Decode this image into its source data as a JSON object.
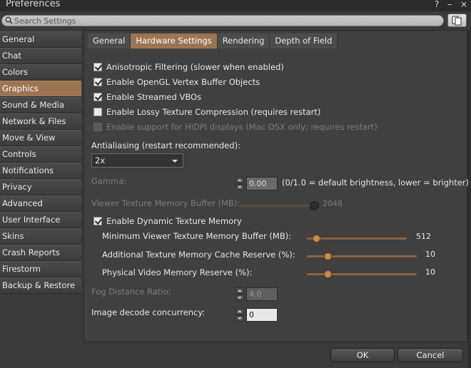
{
  "window": {
    "title": "Preferences",
    "help_glyph": "?",
    "minimize_glyph": "–",
    "close_glyph": "×"
  },
  "search": {
    "placeholder": "Search Settings"
  },
  "sidebar": {
    "items": [
      {
        "label": "General"
      },
      {
        "label": "Chat"
      },
      {
        "label": "Colors"
      },
      {
        "label": "Graphics",
        "active": true
      },
      {
        "label": "Sound & Media"
      },
      {
        "label": "Network & Files"
      },
      {
        "label": "Move & View"
      },
      {
        "label": "Controls"
      },
      {
        "label": "Notifications"
      },
      {
        "label": "Privacy"
      },
      {
        "label": "Advanced"
      },
      {
        "label": "User Interface"
      },
      {
        "label": "Skins"
      },
      {
        "label": "Crash Reports"
      },
      {
        "label": "Firestorm"
      },
      {
        "label": "Backup & Restore"
      }
    ]
  },
  "tabs": [
    {
      "label": "General"
    },
    {
      "label": "Hardware Settings",
      "active": true
    },
    {
      "label": "Rendering"
    },
    {
      "label": "Depth of Field"
    }
  ],
  "hardware": {
    "anisotropic": {
      "label": "Anisotropic Filtering (slower when enabled)",
      "checked": true
    },
    "vbo": {
      "label": "Enable OpenGL Vertex Buffer Objects",
      "checked": true
    },
    "streamed_vbo": {
      "label": "Enable Streamed VBOs",
      "checked": true
    },
    "lossy": {
      "label": "Enable Lossy Texture Compression (requires restart)",
      "checked": false
    },
    "hidpi": {
      "label": "Enable support for HiDPI displays (Mac OSX only; requires restart)",
      "checked": false,
      "disabled": true
    },
    "antialiasing_label": "Antialiasing (restart recommended):",
    "antialiasing_value": "2x",
    "gamma_label": "Gamma:",
    "gamma_value": "0.00",
    "gamma_hint": "(0/1.0 = default brightness, lower = brighter)",
    "vtm_label": "Viewer Texture Memory Buffer (MB):",
    "vtm_value": "2048",
    "dynamic_texture": {
      "label": "Enable Dynamic Texture Memory",
      "checked": true
    },
    "min_vtm_label": "Minimum Viewer Texture Memory Buffer (MB):",
    "min_vtm_value": "512",
    "cache_reserve_label": "Additional Texture Memory Cache Reserve (%):",
    "cache_reserve_value": "10",
    "video_reserve_label": "Physical Video Memory Reserve (%):",
    "video_reserve_value": "10",
    "fog_label": "Fog Distance Ratio:",
    "fog_value": "4.0",
    "decode_label": "Image decode concurrency:",
    "decode_value": "0"
  },
  "buttons": {
    "ok": "OK",
    "cancel": "Cancel"
  },
  "colors": {
    "accent": "#9b7552",
    "panel": "#404040",
    "slider": "#c88a52"
  }
}
